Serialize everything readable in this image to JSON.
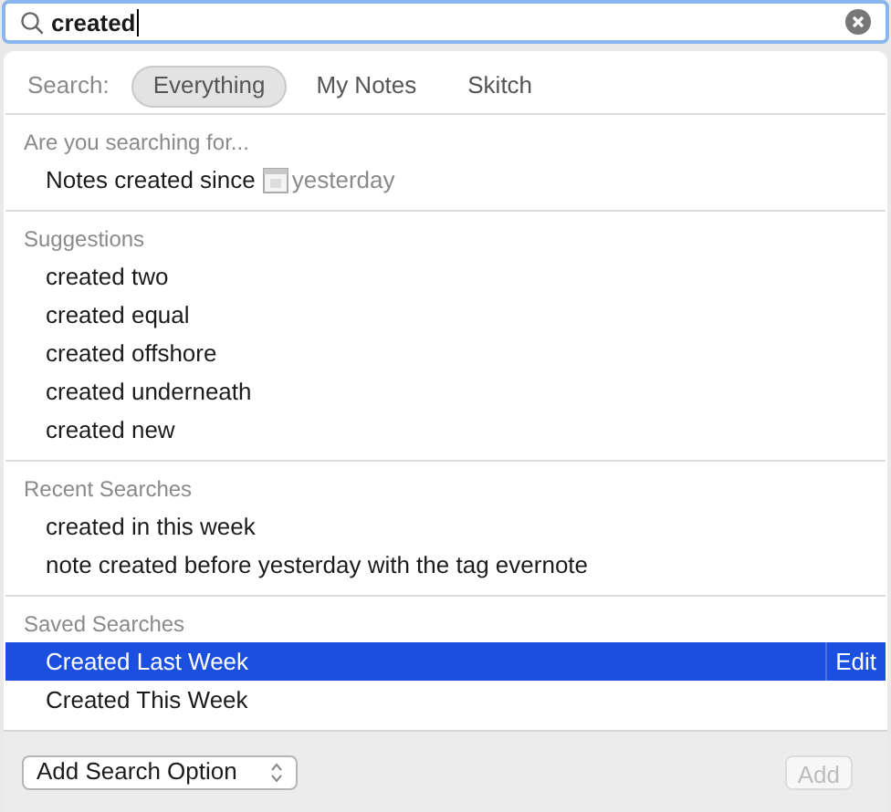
{
  "search": {
    "value": "created"
  },
  "scope": {
    "label": "Search:",
    "options": [
      {
        "label": "Everything",
        "selected": true
      },
      {
        "label": "My Notes",
        "selected": false
      },
      {
        "label": "Skitch",
        "selected": false
      }
    ]
  },
  "sections": [
    {
      "title": "Are you searching for...",
      "items": [
        {
          "kind": "date",
          "text": "Notes created since",
          "date": "yesterday",
          "selected": false
        }
      ]
    },
    {
      "title": "Suggestions",
      "items": [
        {
          "kind": "plain",
          "text": "created two",
          "selected": false
        },
        {
          "kind": "plain",
          "text": "created equal",
          "selected": false
        },
        {
          "kind": "plain",
          "text": "created offshore",
          "selected": false
        },
        {
          "kind": "plain",
          "text": "created underneath",
          "selected": false
        },
        {
          "kind": "plain",
          "text": "created new",
          "selected": false
        }
      ]
    },
    {
      "title": "Recent Searches",
      "items": [
        {
          "kind": "plain",
          "text": "created in this week",
          "selected": false
        },
        {
          "kind": "plain",
          "text": "note created before yesterday with the tag evernote",
          "selected": false
        }
      ]
    },
    {
      "title": "Saved Searches",
      "items": [
        {
          "kind": "plain",
          "text": "Created Last Week",
          "selected": true,
          "action": "Edit"
        },
        {
          "kind": "plain",
          "text": "Created This Week",
          "selected": false
        }
      ]
    }
  ],
  "footer": {
    "select": "Add Search Option",
    "button": {
      "label": "Add",
      "disabled": true
    }
  }
}
